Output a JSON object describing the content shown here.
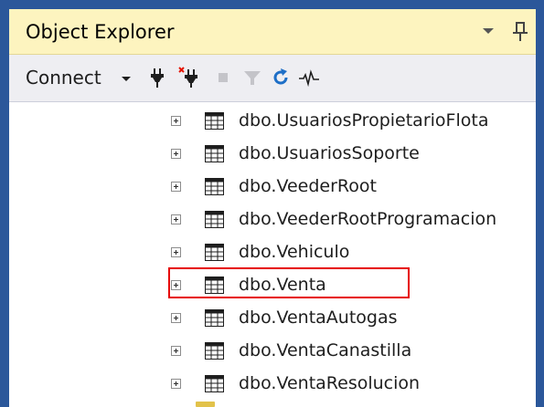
{
  "window": {
    "title": "Object Explorer",
    "dropdown_icon": "dropdown-arrow-icon",
    "pin_icon": "pin-icon",
    "accent_color": "#2b579a",
    "title_background": "#fdf4bf"
  },
  "toolbar": {
    "connect_label": "Connect",
    "icons": [
      "connect-plug-icon",
      "disconnect-icon",
      "stop-icon",
      "filter-icon",
      "refresh-icon",
      "activity-monitor-icon"
    ]
  },
  "tree": {
    "items": [
      {
        "label": "dbo.UsuariosPropietarioFlota",
        "icon": "table-icon"
      },
      {
        "label": "dbo.UsuariosSoporte",
        "icon": "table-icon"
      },
      {
        "label": "dbo.VeederRoot",
        "icon": "table-icon"
      },
      {
        "label": "dbo.VeederRootProgramacion",
        "icon": "table-icon"
      },
      {
        "label": "dbo.Vehiculo",
        "icon": "table-icon"
      },
      {
        "label": "dbo.Venta",
        "icon": "table-icon",
        "highlighted": true
      },
      {
        "label": "dbo.VentaAutogas",
        "icon": "table-icon"
      },
      {
        "label": "dbo.VentaCanastilla",
        "icon": "table-icon"
      },
      {
        "label": "dbo.VentaResolucion",
        "icon": "table-icon"
      }
    ],
    "highlight_color": "#e60000"
  }
}
